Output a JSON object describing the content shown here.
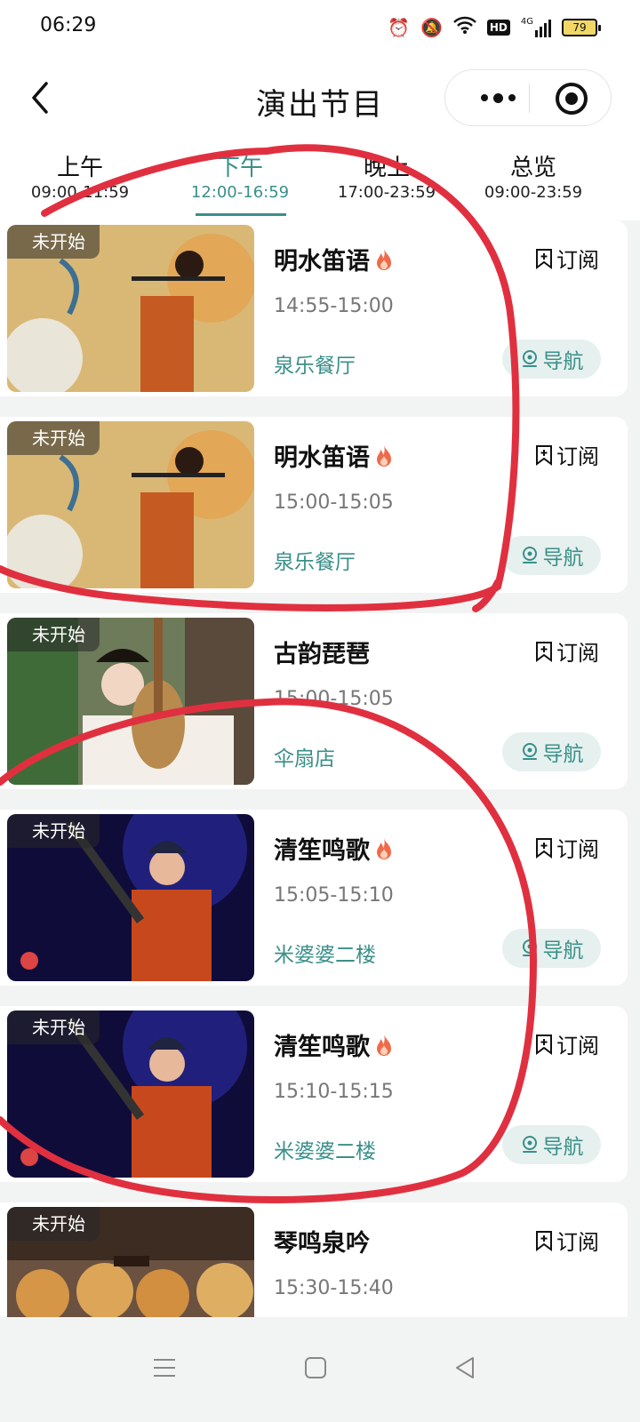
{
  "status_bar": {
    "time": "06:29",
    "network": "4G",
    "battery": "79"
  },
  "header": {
    "title": "演出节目"
  },
  "tabs": [
    {
      "label": "上午",
      "range": "09:00-11:59",
      "active": false
    },
    {
      "label": "下午",
      "range": "12:00-16:59",
      "active": true
    },
    {
      "label": "晚上",
      "range": "17:00-23:59",
      "active": false
    },
    {
      "label": "总览",
      "range": "09:00-23:59",
      "active": false
    }
  ],
  "common": {
    "status_tag": "未开始",
    "subscribe_label": "订阅",
    "navigate_label": "导航"
  },
  "performances": [
    {
      "title": "明水笛语",
      "hot": true,
      "time": "14:55-15:00",
      "venue": "泉乐餐厅",
      "image": "flute-player"
    },
    {
      "title": "明水笛语",
      "hot": true,
      "time": "15:00-15:05",
      "venue": "泉乐餐厅",
      "image": "flute-player"
    },
    {
      "title": "古韵琵琶",
      "hot": false,
      "time": "15:00-15:05",
      "venue": "伞扇店",
      "image": "pipa-player"
    },
    {
      "title": "清笙鸣歌",
      "hot": true,
      "time": "15:05-15:10",
      "venue": "米婆婆二楼",
      "image": "sheng-player"
    },
    {
      "title": "清笙鸣歌",
      "hot": true,
      "time": "15:10-15:15",
      "venue": "米婆婆二楼",
      "image": "sheng-player"
    },
    {
      "title": "琴鸣泉吟",
      "hot": false,
      "time": "15:30-15:40",
      "venue": "",
      "image": "guqin-umbrellas"
    }
  ],
  "colors": {
    "accent": "#3a8f89",
    "annotation": "#e03040"
  }
}
